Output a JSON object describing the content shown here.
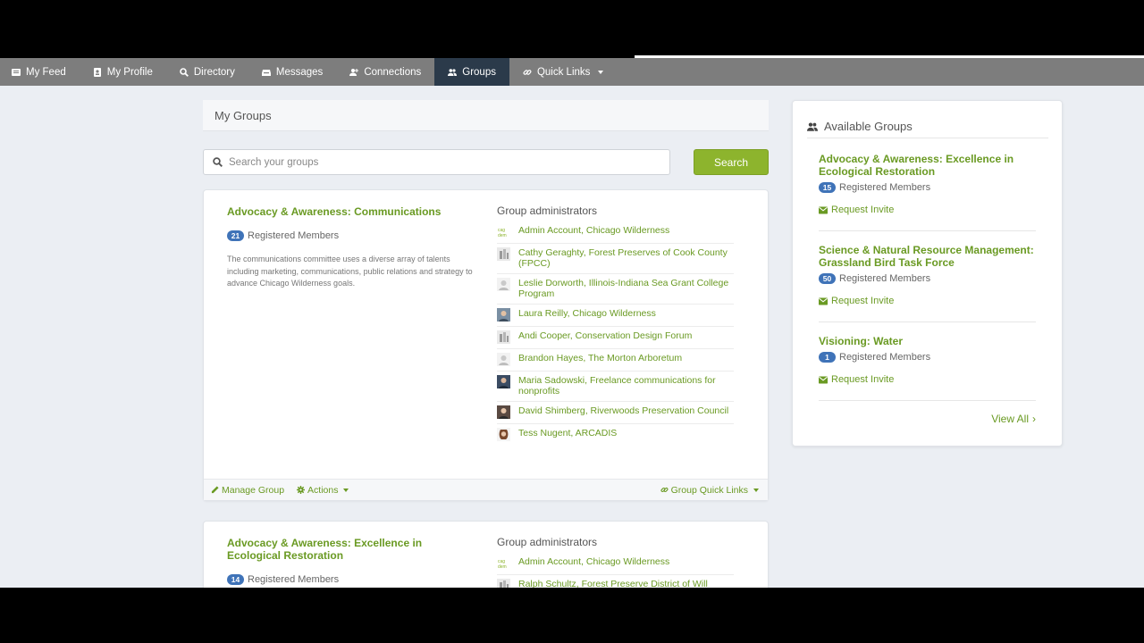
{
  "nav": {
    "items": [
      {
        "label": "My Feed",
        "icon": "newspaper-icon"
      },
      {
        "label": "My Profile",
        "icon": "id-card-icon"
      },
      {
        "label": "Directory",
        "icon": "search-icon"
      },
      {
        "label": "Messages",
        "icon": "inbox-icon"
      },
      {
        "label": "Connections",
        "icon": "user-plus-icon"
      },
      {
        "label": "Groups",
        "icon": "users-icon",
        "active": true
      },
      {
        "label": "Quick Links",
        "icon": "link-icon"
      }
    ]
  },
  "my_groups": {
    "title": "My Groups",
    "search_placeholder": "Search your groups",
    "search_button": "Search",
    "groups": [
      {
        "title": "Advocacy & Awareness: Communications",
        "member_count": "21",
        "members_label": "Registered Members",
        "description": "The communications committee uses a diverse array of talents including marketing, communications, public relations and strategy to advance Chicago Wilderness goals.",
        "admins_heading": "Group administrators",
        "admins": [
          "Admin Account, Chicago Wilderness",
          "Cathy Geraghty, Forest Preserves of Cook County (FPCC)",
          "Leslie Dorworth, Illinois-Indiana Sea Grant College Program",
          "Laura Reilly, Chicago Wilderness",
          "Andi Cooper, Conservation Design Forum",
          "Brandon Hayes, The Morton Arboretum",
          "Maria Sadowski, Freelance communications for nonprofits",
          "David Shimberg, Riverwoods Preservation Council",
          "Tess Nugent, ARCADIS"
        ],
        "footer": {
          "manage": "Manage Group",
          "actions": "Actions",
          "quick_links": "Group Quick Links"
        }
      },
      {
        "title": "Advocacy & Awareness: Excellence in Ecological Restoration",
        "member_count": "14",
        "members_label": "Registered Members",
        "admins_heading": "Group administrators",
        "admins": [
          "Admin Account, Chicago Wilderness",
          "Ralph Schultz, Forest Preserve District of Will County"
        ]
      }
    ]
  },
  "available_groups": {
    "title": "Available Groups",
    "groups": [
      {
        "title": "Advocacy & Awareness: Excellence in Ecological Restoration",
        "member_count": "15",
        "members_label": "Registered Members",
        "invite": "Request Invite"
      },
      {
        "title": "Science & Natural Resource Management: Grassland Bird Task Force",
        "member_count": "50",
        "members_label": "Registered Members",
        "invite": "Request Invite"
      },
      {
        "title": "Visioning: Water",
        "member_count": "1",
        "members_label": "Registered Members",
        "invite": "Request Invite"
      }
    ],
    "view_all": "View All"
  },
  "colors": {
    "accent_green": "#6a9a23",
    "button_green": "#8db42d",
    "nav_bg": "#7d7d7d",
    "nav_active": "#2b3a4a",
    "badge_blue": "#3f73b8"
  }
}
